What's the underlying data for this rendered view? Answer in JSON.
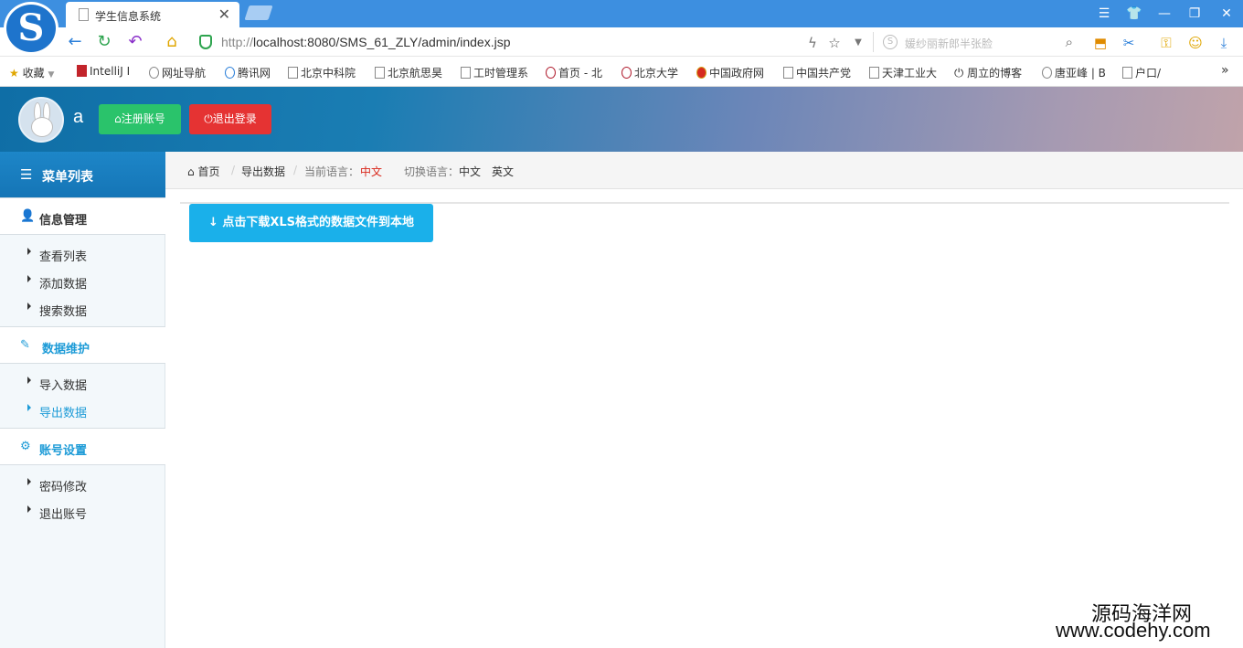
{
  "browser": {
    "tab_title": "学生信息系统",
    "tab_close": "✕",
    "url_prefix": "http://",
    "url_host": "localhost",
    "url_rest": ":8080/SMS_61_ZLY/admin/index.jsp",
    "search_placeholder": "媛纱丽新郎半张脸",
    "bookmarks": [
      "收藏",
      "IntelliJ I",
      "网址导航",
      "腾讯网",
      "北京中科院",
      "北京航思昊",
      "工时管理系",
      "首页 - 北",
      "北京大学",
      "中国政府网",
      "中国共产党",
      "天津工业大",
      "周立的博客",
      "唐亚峰 | B",
      "户口/"
    ]
  },
  "header": {
    "username": "a",
    "register_label": "注册账号",
    "logout_label": "退出登录"
  },
  "sidebar": {
    "title": "菜单列表",
    "groups": [
      {
        "label": "信息管理",
        "items": [
          {
            "label": "查看列表"
          },
          {
            "label": "添加数据"
          },
          {
            "label": "搜索数据"
          }
        ]
      },
      {
        "label": "数据维护",
        "items": [
          {
            "label": "导入数据"
          },
          {
            "label": "导出数据"
          }
        ]
      },
      {
        "label": "账号设置",
        "items": [
          {
            "label": "密码修改"
          },
          {
            "label": "退出账号"
          }
        ]
      }
    ],
    "active_item": "导出数据",
    "active_color": "#1d9bd7"
  },
  "breadcrumb": {
    "home": "首页",
    "current": "导出数据",
    "lang_label": "当前语言：",
    "lang_value": "中文",
    "switch_label": "切换语言：",
    "switch_zh": "中文",
    "switch_en": "英文"
  },
  "main": {
    "download_label": "↓ 点击下载XLS格式的数据文件到本地"
  },
  "watermark": {
    "cn": "源码海洋网",
    "url": "www.codehy.com"
  }
}
